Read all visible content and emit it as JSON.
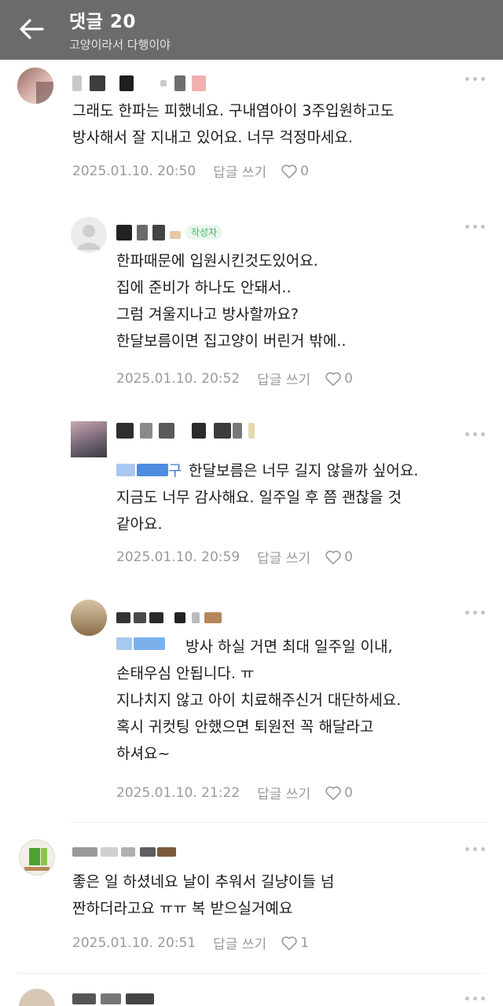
{
  "header": {
    "title": "댓글 20",
    "subtitle": "고양이라서 다행이야"
  },
  "comments": [
    {
      "text": "그래도 한파는 피했네요. 구내염아이 3주입원하고도\n방사해서 잘 지내고 있어요. 너무 걱정마세요.",
      "date": "2025.01.10. 20:50",
      "reply_label": "답글 쓰기",
      "likes": "0"
    },
    {
      "badge": "작성자",
      "text": "한파때문에 입원시킨것도있어요.\n집에 준비가 하나도 안돼서..\n그럼 겨울지나고 방사할까요?\n한달보름이면 집고양이 버린거 밖에..",
      "date": "2025.01.10. 20:52",
      "reply_label": "답글 쓰기",
      "likes": "0"
    },
    {
      "text": "한달보름은 너무 길지 않을까 싶어요.\n지금도 너무 감사해요. 일주일 후 쯤 괜찮을 것\n같아요.",
      "mention_suffix": "구",
      "date": "2025.01.10. 20:59",
      "reply_label": "답글 쓰기",
      "likes": "0"
    },
    {
      "text": "방사 하실 거면 최대 일주일 이내,\n손태우심 안됩니다. ㅠ\n지나치지 않고 아이 치료해주신거 대단하세요.\n혹시 귀컷팅 안했으면 퇴원전 꼭 해달라고\n하셔요~",
      "date": "2025.01.10. 21:22",
      "reply_label": "답글 쓰기",
      "likes": "0"
    },
    {
      "text": "좋은 일 하셨네요 날이 추워서 길냥이들 넘\n짠하더라고요 ㅠㅠ 복 받으실거예요",
      "date": "2025.01.10. 20:51",
      "reply_label": "답글 쓰기",
      "likes": "1"
    }
  ],
  "icons": {
    "back": "arrow-left-icon",
    "more": "more-dots-icon",
    "like": "heart-outline-icon"
  },
  "colors": {
    "header_bg": "#6b6b6b",
    "author_badge": "#3fb75e",
    "meta_text": "#9a9a9a"
  }
}
